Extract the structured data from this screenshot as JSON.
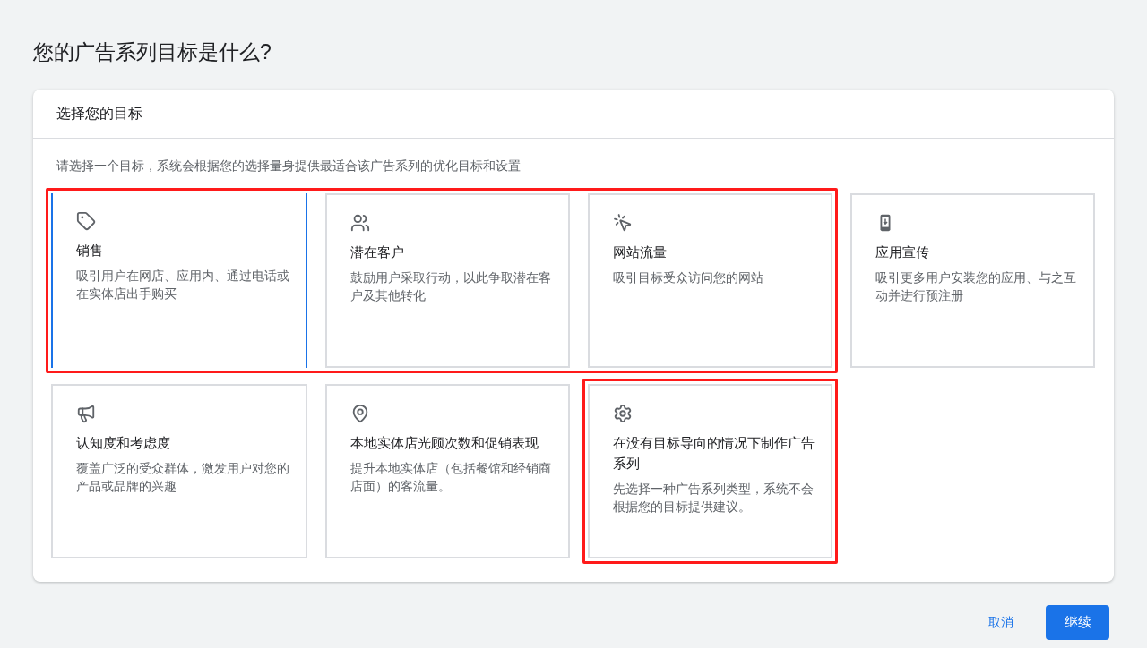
{
  "title": "您的广告系列目标是什么?",
  "panel": {
    "heading": "选择您的目标",
    "description": "请选择一个目标，系统会根据您的选择量身提供最适合该广告系列的优化目标和设置",
    "cards": [
      {
        "title": "销售",
        "text": "吸引用户在网店、应用内、通过电话或在实体店出手购买",
        "selected": true,
        "highlighted": true
      },
      {
        "title": "潜在客户",
        "text": "鼓励用户采取行动，以此争取潜在客户及其他转化",
        "selected": false,
        "highlighted": true
      },
      {
        "title": "网站流量",
        "text": "吸引目标受众访问您的网站",
        "selected": false,
        "highlighted": true
      },
      {
        "title": "应用宣传",
        "text": "吸引更多用户安装您的应用、与之互动并进行预注册",
        "selected": false,
        "highlighted": false
      },
      {
        "title": "认知度和考虑度",
        "text": "覆盖广泛的受众群体，激发用户对您的产品或品牌的兴趣",
        "selected": false,
        "highlighted": false
      },
      {
        "title": "本地实体店光顾次数和促销表现",
        "text": "提升本地实体店（包括餐馆和经销商店面）的客流量。",
        "selected": false,
        "highlighted": false
      },
      {
        "title": "在没有目标导向的情况下制作广告系列",
        "text": "先选择一种广告系列类型，系统不会根据您的目标提供建议。",
        "selected": false,
        "highlighted": true
      }
    ]
  },
  "buttons": {
    "cancel": "取消",
    "continue": "继续"
  }
}
